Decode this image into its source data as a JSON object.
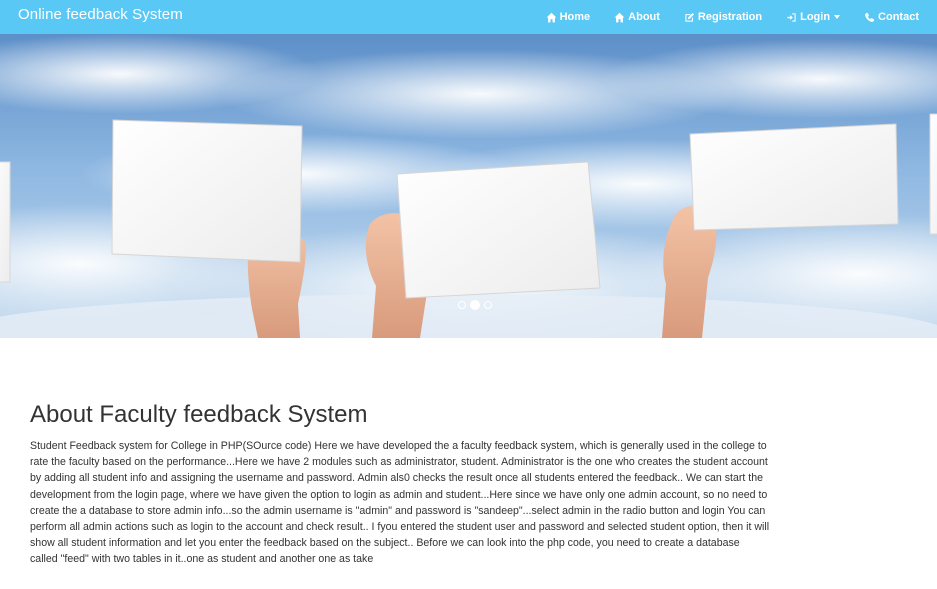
{
  "navbar": {
    "brand": "Online feedback System",
    "items": [
      {
        "label": "Home",
        "icon": "home-icon"
      },
      {
        "label": "About",
        "icon": "home-icon"
      },
      {
        "label": "Registration",
        "icon": "edit-icon"
      },
      {
        "label": "Login",
        "icon": "login-icon"
      },
      {
        "label": "Contact",
        "icon": "phone-icon"
      }
    ],
    "background_color": "#5ac8f5"
  },
  "carousel": {
    "slide_count": 3,
    "active_index": 1
  },
  "about": {
    "heading": "About Faculty feedback System",
    "paragraph": "Student Feedback system for College in PHP(SOurce code) Here we have developed the a faculty feedback system, which is generally used in the college to rate the faculty based on the performance...Here we have 2 modules such as administrator, student. Administrator is the one who creates the student account by adding all student info and assigning the username and password. Admin als0 checks the result once all students entered the feedback.. We can start the development from the login page, where we have given the option to login as admin and student...Here since we have only one admin account, so no need to create the a database to store admin info...so the admin username is \"admin\" and password is \"sandeep\"...select admin in the radio button and login You can perform all admin actions such as login to the account and check result.. I fyou entered the student user and password and selected student option, then it will show all student information and let you enter the feedback based on the subject.. Before we can look into the php code, you need to create a database called \"feed\" with two tables in it..one as student and another one as take"
  }
}
